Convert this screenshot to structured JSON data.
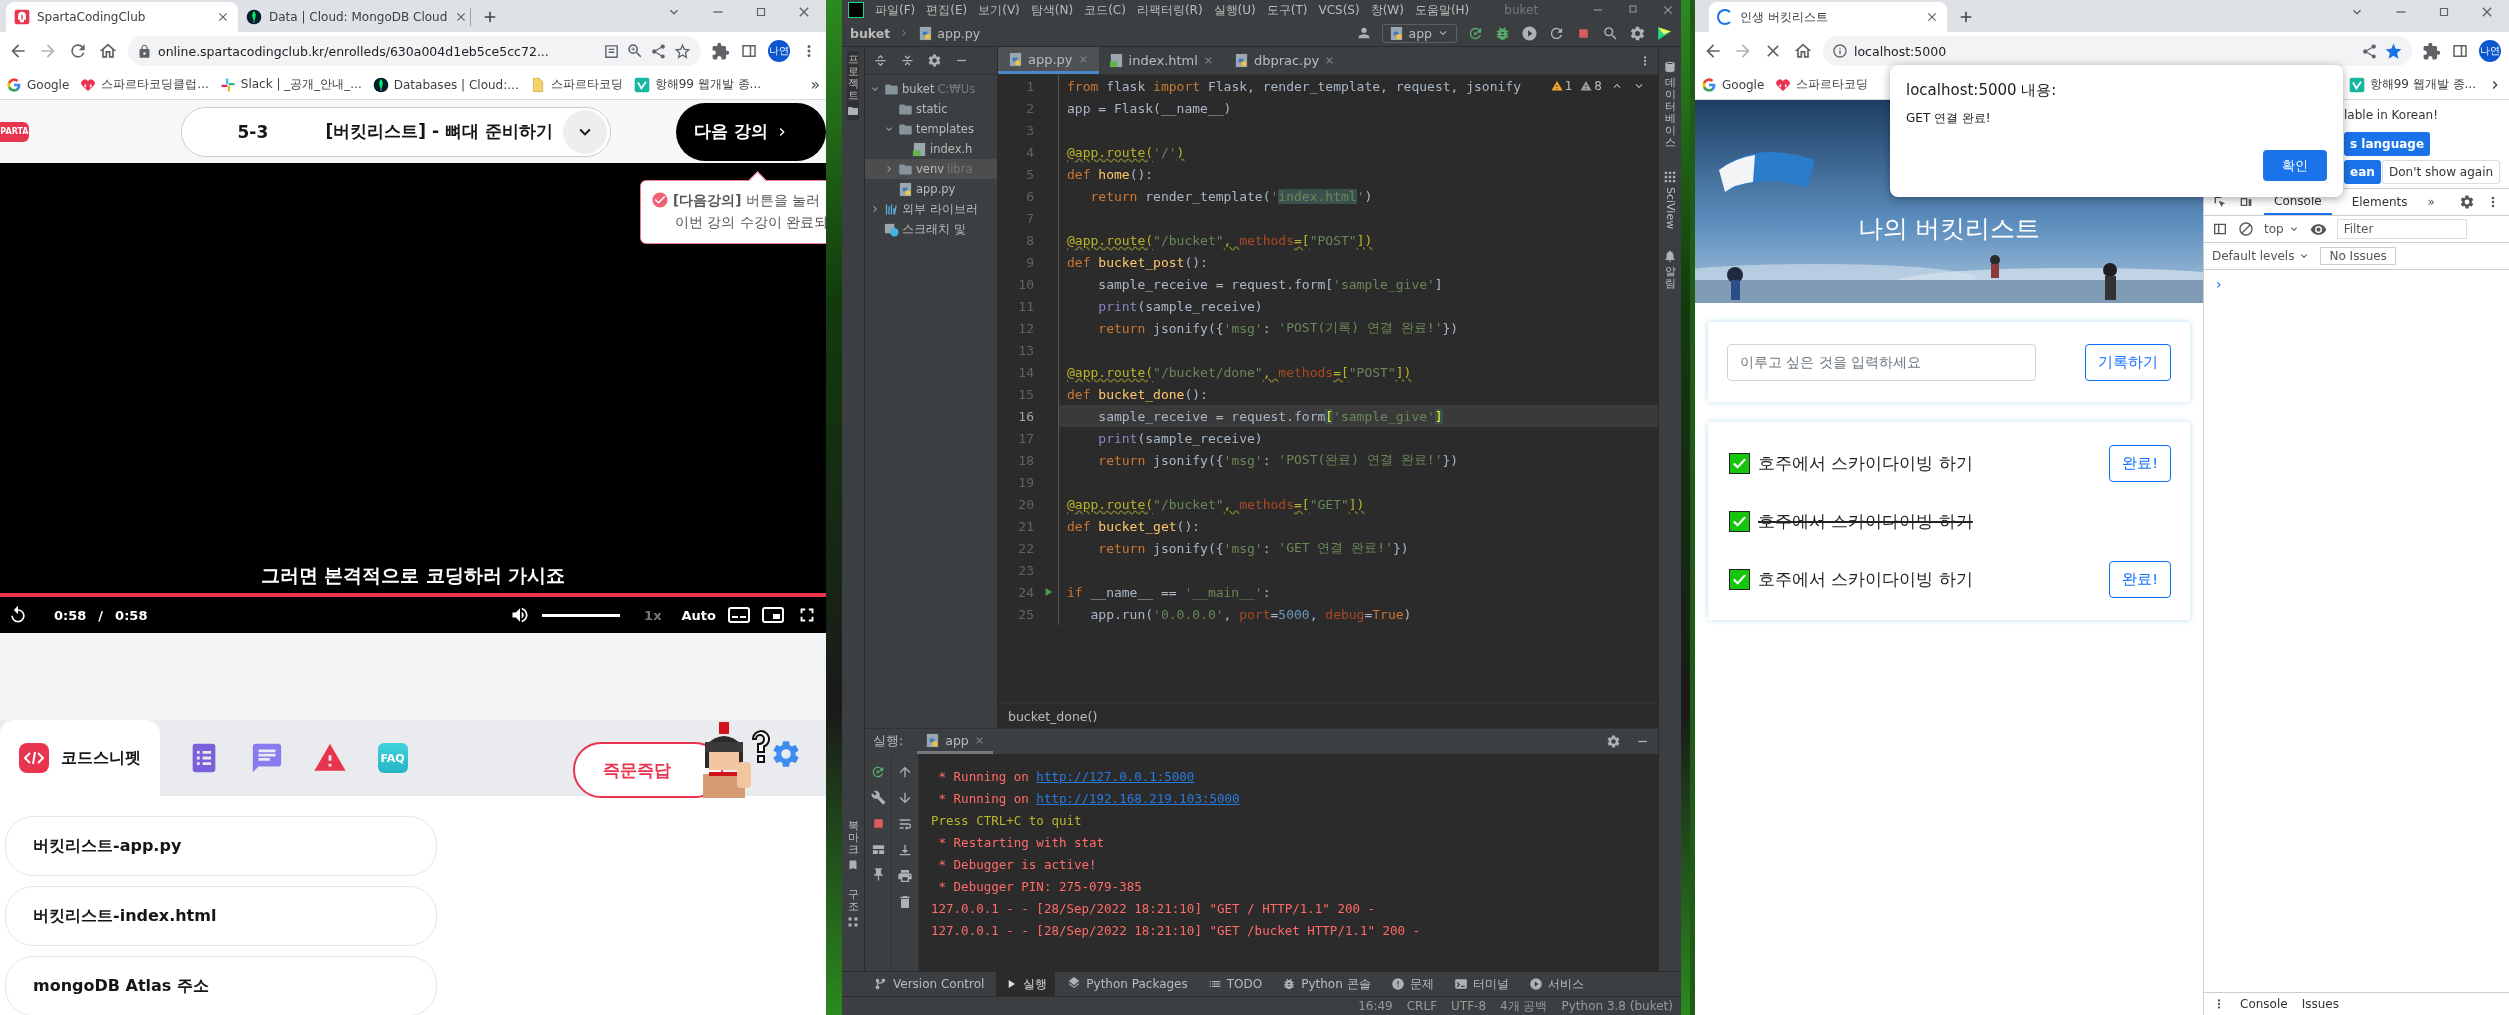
{
  "left_browser": {
    "tabs": [
      {
        "kind": "sparta",
        "title": "SpartaCodingClub",
        "selected": true
      },
      {
        "kind": "mongodb",
        "title": "Data | Cloud: MongoDB Cloud",
        "selected": false
      }
    ],
    "url": "online.spartacodingclub.kr/enrolleds/630a004d1eb5ce5cc72...",
    "profile": "나연",
    "bookmarks": [
      {
        "kind": "google",
        "title": "Google"
      },
      {
        "kind": "sparta",
        "title": "스파르타코딩클럽..."
      },
      {
        "kind": "slack",
        "title": "Slack | _공개_안내_..."
      },
      {
        "kind": "mongodb",
        "title": "Databases | Cloud:..."
      },
      {
        "kind": "folder",
        "title": "스파르타코딩"
      },
      {
        "kind": "vimeo",
        "title": "항해99 웹개발 종..."
      }
    ],
    "bookmarks_more": "»",
    "logo_text": "PARTA",
    "lecture": {
      "number": "5-3",
      "title": "[버킷리스트] - 뼈대 준비하기",
      "next_button": "다음 강의"
    },
    "tooltip": [
      "**[다음강의]** 버튼을 눌러",
      "이번 강의 수강이 완료되"
    ],
    "video": {
      "caption": "그러면 본격적으로 코딩하러 가시죠",
      "progress": {
        "level": 1
      },
      "current_time": "0:58",
      "separator": "/",
      "duration": "0:58",
      "volume": {
        "level": 1
      },
      "speed": "1x",
      "quality": "Auto"
    },
    "panel_tabs": [
      {
        "kind": "snippet",
        "label": "코드스니펫",
        "selected": true
      },
      {
        "kind": "checklist",
        "selected": false
      },
      {
        "kind": "chat",
        "selected": false
      },
      {
        "kind": "warning",
        "selected": false
      },
      {
        "kind": "faq",
        "label": "FAQ",
        "selected": false
      }
    ],
    "ask_button": "즉문즉답",
    "snippets": [
      "버킷리스트-app.py",
      "버킷리스트-index.html",
      "mongoDB Atlas 주소"
    ]
  },
  "ide": {
    "menu": [
      "파일(F)",
      "편집(E)",
      "보기(V)",
      "탐색(N)",
      "코드(C)",
      "리팩터링(R)",
      "실행(U)",
      "도구(T)",
      "VCS(S)",
      "창(W)",
      "도움말(H)"
    ],
    "title": "buket",
    "breadcrumb": [
      "buket",
      "app.py"
    ],
    "run_config": "app",
    "left_strip_top": "프로젝트",
    "left_strip_bottom": [
      "북마크",
      "구조"
    ],
    "right_strip": [
      {
        "kind": "database",
        "label": "데이터베이스"
      },
      {
        "kind": "sciview",
        "label": "SciView"
      },
      {
        "kind": "bell",
        "label": "알림"
      }
    ],
    "project_tree": [
      {
        "kind": "folder",
        "name": "buket",
        "hint": "C:₩Us",
        "expanded": true,
        "selected": false,
        "children": [
          {
            "kind": "folder",
            "name": "static",
            "selected": false
          },
          {
            "kind": "folder",
            "name": "templates",
            "expanded": true,
            "selected": false,
            "children": [
              {
                "kind": "html",
                "name": "index.h",
                "selected": false
              }
            ]
          },
          {
            "kind": "folder",
            "name": "venv",
            "hint": "libra",
            "expanded": false,
            "selected": true
          },
          {
            "kind": "python",
            "name": "app.py",
            "selected": false
          }
        ]
      },
      {
        "kind": "library",
        "name": "외부 라이브러",
        "expanded": false,
        "selected": false
      },
      {
        "kind": "scratch",
        "name": "스크래치 및",
        "selected": false
      }
    ],
    "editor_tabs": [
      {
        "kind": "python",
        "name": "app.py",
        "selected": true
      },
      {
        "kind": "html",
        "name": "index.html",
        "selected": false
      },
      {
        "kind": "python",
        "name": "dbprac.py",
        "selected": false
      }
    ],
    "inspections": {
      "warnings": "1",
      "weak_warnings": "8"
    },
    "code": [
      {
        "n": "1",
        "current": false,
        "tokens": [
          {
            "kind": "kw",
            "text": "from "
          },
          {
            "kind": "p",
            "text": "flask "
          },
          {
            "kind": "kw",
            "text": "import "
          },
          {
            "kind": "p",
            "text": "Flask, render_template, request, jsonify"
          }
        ]
      },
      {
        "n": "2",
        "current": false,
        "tokens": [
          {
            "kind": "p",
            "text": "app = Flask(__name__)"
          }
        ]
      },
      {
        "n": "3",
        "current": false
      },
      {
        "n": "4",
        "current": false,
        "tokens": [
          {
            "kind": "dec",
            "text": "@app.route("
          },
          {
            "kind": "s",
            "text": "'/'"
          },
          {
            "kind": "dec",
            "text": ")"
          }
        ]
      },
      {
        "n": "5",
        "current": false,
        "tokens": [
          {
            "kind": "kw",
            "text": "def "
          },
          {
            "kind": "fn",
            "text": "home"
          },
          {
            "kind": "p",
            "text": "():"
          }
        ]
      },
      {
        "n": "6",
        "current": false,
        "tokens": [
          {
            "kind": "kw",
            "text": "   return"
          },
          {
            "kind": "p",
            "text": " render_template("
          },
          {
            "kind": "s",
            "text": "'"
          },
          {
            "kind": "hl",
            "text": "index.html"
          },
          {
            "kind": "s",
            "text": "'"
          },
          {
            "kind": "p",
            "text": ")"
          }
        ]
      },
      {
        "n": "7",
        "current": false
      },
      {
        "n": "8",
        "current": false,
        "tokens": [
          {
            "kind": "dec",
            "text": "@app.route("
          },
          {
            "kind": "s",
            "text": "\"/bucket\""
          },
          {
            "kind": "dec",
            "text": ", "
          },
          {
            "kind": "prm",
            "text": "methods"
          },
          {
            "kind": "dec",
            "text": "=["
          },
          {
            "kind": "s",
            "text": "\"POST\""
          },
          {
            "kind": "dec",
            "text": "])"
          }
        ]
      },
      {
        "n": "9",
        "current": false,
        "tokens": [
          {
            "kind": "kw",
            "text": "def "
          },
          {
            "kind": "fn",
            "text": "bucket_post"
          },
          {
            "kind": "p",
            "text": "():"
          }
        ]
      },
      {
        "n": "10",
        "current": false,
        "tokens": [
          {
            "kind": "p",
            "text": "    sample_receive = request.form["
          },
          {
            "kind": "s",
            "text": "'sample_give'"
          },
          {
            "kind": "p",
            "text": "]"
          }
        ]
      },
      {
        "n": "11",
        "current": false,
        "tokens": [
          {
            "kind": "b",
            "text": "    print"
          },
          {
            "kind": "p",
            "text": "(sample_receive)"
          }
        ]
      },
      {
        "n": "12",
        "current": false,
        "tokens": [
          {
            "kind": "kw",
            "text": "    return"
          },
          {
            "kind": "p",
            "text": " jsonify({"
          },
          {
            "kind": "s",
            "text": "'msg'"
          },
          {
            "kind": "p",
            "text": ": "
          },
          {
            "kind": "s",
            "text": "'POST(기록) 연결 완료!'"
          },
          {
            "kind": "p",
            "text": "})"
          }
        ]
      },
      {
        "n": "13",
        "current": false
      },
      {
        "n": "14",
        "current": false,
        "tokens": [
          {
            "kind": "dec",
            "text": "@app.route("
          },
          {
            "kind": "s",
            "text": "\"/bucket/done\""
          },
          {
            "kind": "dec",
            "text": ", "
          },
          {
            "kind": "prm",
            "text": "methods"
          },
          {
            "kind": "dec",
            "text": "=["
          },
          {
            "kind": "s",
            "text": "\"POST\""
          },
          {
            "kind": "dec",
            "text": "])"
          }
        ]
      },
      {
        "n": "15",
        "current": false,
        "tokens": [
          {
            "kind": "kw",
            "text": "def "
          },
          {
            "kind": "fn",
            "text": "bucket_done"
          },
          {
            "kind": "p",
            "text": "():"
          }
        ]
      },
      {
        "n": "16",
        "current": true,
        "tokens": [
          {
            "kind": "p",
            "text": "    sample_receive = request.form"
          },
          {
            "kind": "br",
            "text": "["
          },
          {
            "kind": "s",
            "text": "'sample_give'"
          },
          {
            "kind": "br",
            "text": "]"
          }
        ]
      },
      {
        "n": "17",
        "current": false,
        "tokens": [
          {
            "kind": "b",
            "text": "    print"
          },
          {
            "kind": "p",
            "text": "(sample_receive)"
          }
        ]
      },
      {
        "n": "18",
        "current": false,
        "tokens": [
          {
            "kind": "kw",
            "text": "    return"
          },
          {
            "kind": "p",
            "text": " jsonify({"
          },
          {
            "kind": "s",
            "text": "'msg'"
          },
          {
            "kind": "p",
            "text": ": "
          },
          {
            "kind": "s",
            "text": "'POST(완료) 연결 완료!'"
          },
          {
            "kind": "p",
            "text": "})"
          }
        ]
      },
      {
        "n": "19",
        "current": false
      },
      {
        "n": "20",
        "current": false,
        "tokens": [
          {
            "kind": "dec",
            "text": "@app.route("
          },
          {
            "kind": "s",
            "text": "\"/bucket\""
          },
          {
            "kind": "dec",
            "text": ", "
          },
          {
            "kind": "prm",
            "text": "methods"
          },
          {
            "kind": "dec",
            "text": "=["
          },
          {
            "kind": "s",
            "text": "\"GET\""
          },
          {
            "kind": "dec",
            "text": "])"
          }
        ]
      },
      {
        "n": "21",
        "current": false,
        "tokens": [
          {
            "kind": "kw",
            "text": "def "
          },
          {
            "kind": "fn",
            "text": "bucket_get"
          },
          {
            "kind": "p",
            "text": "():"
          }
        ]
      },
      {
        "n": "22",
        "current": false,
        "tokens": [
          {
            "kind": "kw",
            "text": "    return"
          },
          {
            "kind": "p",
            "text": " jsonify({"
          },
          {
            "kind": "s",
            "text": "'msg'"
          },
          {
            "kind": "p",
            "text": ": "
          },
          {
            "kind": "s",
            "text": "'GET 연결 완료!'"
          },
          {
            "kind": "p",
            "text": "})"
          }
        ]
      },
      {
        "n": "23",
        "current": false
      },
      {
        "n": "24",
        "current": false,
        "runnable": true,
        "tokens": [
          {
            "kind": "kw",
            "text": "if "
          },
          {
            "kind": "p",
            "text": "__name__ == "
          },
          {
            "kind": "s",
            "text": "'__main__'"
          },
          {
            "kind": "p",
            "text": ":"
          }
        ]
      },
      {
        "n": "25",
        "current": false,
        "tokens": [
          {
            "kind": "p",
            "text": "   app.run("
          },
          {
            "kind": "s",
            "text": "'0.0.0.0'"
          },
          {
            "kind": "p",
            "text": ", "
          },
          {
            "kind": "prm",
            "text": "port"
          },
          {
            "kind": "p",
            "text": "="
          },
          {
            "kind": "num",
            "text": "5000"
          },
          {
            "kind": "p",
            "text": ", "
          },
          {
            "kind": "prm",
            "text": "debug"
          },
          {
            "kind": "p",
            "text": "="
          },
          {
            "kind": "kw",
            "text": "True"
          },
          {
            "kind": "p",
            "text": ")"
          }
        ]
      }
    ],
    "function_breadcrumb": "bucket_done()",
    "run_panel": {
      "label": "실행:",
      "tab": "app",
      "lines": [
        {
          "kind": "stderr",
          "text": " * Running on ",
          "link": "http://127.0.0.1:5000"
        },
        {
          "kind": "stderr",
          "text": " * Running on ",
          "link": "http://192.168.219.103:5000"
        },
        {
          "kind": "notice",
          "text": "Press CTRL+C to quit"
        },
        {
          "kind": "stderr",
          "text": " * Restarting with stat"
        },
        {
          "kind": "stderr",
          "text": " * Debugger is active!"
        },
        {
          "kind": "stderr",
          "text": " * Debugger PIN: 275-079-385"
        },
        {
          "kind": "stderr",
          "text": "127.0.0.1 - - [28/Sep/2022 18:21:10] \"GET / HTTP/1.1\" 200 -"
        },
        {
          "kind": "stderr",
          "text": "127.0.0.1 - - [28/Sep/2022 18:21:10] \"GET /bucket HTTP/1.1\" 200 -"
        }
      ]
    },
    "tool_tabs": [
      {
        "kind": "vcs",
        "label": "Version Control",
        "selected": false
      },
      {
        "kind": "run",
        "label": "실행",
        "selected": true
      },
      {
        "kind": "packages",
        "label": "Python Packages",
        "selected": false
      },
      {
        "kind": "todo",
        "label": "TODO",
        "selected": false
      },
      {
        "kind": "console",
        "label": "Python 콘솔",
        "selected": false
      },
      {
        "kind": "problems",
        "label": "문제",
        "selected": false
      },
      {
        "kind": "terminal",
        "label": "터미널",
        "selected": false
      },
      {
        "kind": "services",
        "label": "서비스",
        "selected": false
      }
    ],
    "status": [
      "16:49",
      "CRLF",
      "UTF-8",
      "4개 공백",
      "Python 3.8 (buket)"
    ]
  },
  "right_browser": {
    "tabs": [
      {
        "title": "인생 버킷리스트",
        "selected": true,
        "loading": true
      }
    ],
    "url": "localhost:5000",
    "profile": "나연",
    "bookmarks": [
      {
        "kind": "google",
        "title": "Google"
      },
      {
        "kind": "sparta",
        "title": "스파르타코딩"
      }
    ],
    "bookmark_end": {
      "kind": "vimeo",
      "title": "항해99 웹개발 종..."
    },
    "page": {
      "title": "나의 버킷리스트",
      "input": {
        "placeholder": "이루고 싶은 것을 입력하세요"
      },
      "record_button": "기록하기",
      "items": [
        {
          "text": "호주에서 스카이다이빙 하기",
          "checked": true,
          "done": false,
          "button": "완료!"
        },
        {
          "text": "호주에서 스카이다이빙 하기",
          "checked": true,
          "done": true
        },
        {
          "text": "호주에서 스카이다이빙 하기",
          "checked": true,
          "done": false,
          "button": "완료!"
        }
      ]
    },
    "translate_popup": {
      "message": "lable in Korean!",
      "buttons": [
        {
          "label": "s language",
          "primary": true
        },
        {
          "label": "ean",
          "primary": true
        },
        {
          "label": "Don't show again",
          "primary": false
        }
      ]
    },
    "devtools": {
      "tabs": [
        {
          "label": "Console",
          "selected": true
        },
        {
          "label": "Elements",
          "selected": false
        }
      ],
      "more": "»",
      "context": "top",
      "filter": {
        "placeholder": "Filter"
      },
      "levels": "Default levels",
      "issues": "No Issues",
      "prompt": "›",
      "drawer_tabs": [
        "Console",
        "Issues"
      ]
    },
    "dialog": {
      "title": "localhost:5000 내용:",
      "message": "GET 연결 완료!",
      "button": "확인"
    }
  }
}
